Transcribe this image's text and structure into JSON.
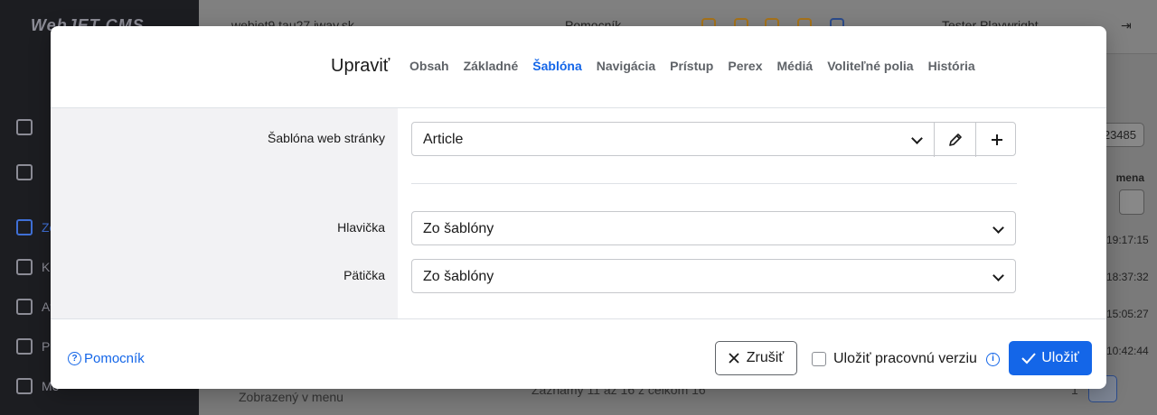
{
  "background": {
    "sidebar": {
      "logo": "WebJET CMS",
      "items": [
        {
          "label": "",
          "icon": "home-icon"
        },
        {
          "label": "",
          "icon": "folder-icon"
        },
        {
          "label": "Zo",
          "icon": "document-icon",
          "active": true
        },
        {
          "label": "Kl",
          "icon": "copy-icon"
        },
        {
          "label": "At",
          "icon": "file-icon"
        },
        {
          "label": "Pre",
          "icon": "export-icon"
        },
        {
          "label": "Mé",
          "icon": "upload-icon"
        }
      ]
    },
    "topbar": {
      "domain": "webjet9.tau27.iway.sk",
      "help": "Pomocník",
      "user": "Tester Playwright"
    },
    "right_column": {
      "id_value": "23485",
      "col_header": "mena",
      "times": [
        "19:17:15",
        "18:37:32",
        "15:05:27",
        "10:42:44"
      ]
    },
    "footer": {
      "folder_label": "Zobrazený v menu",
      "records": "Záznamy 11 až 16 z celkom 16",
      "page_prev": "1",
      "page_current": "2"
    }
  },
  "modal": {
    "title": "Upraviť",
    "tabs": [
      {
        "label": "Obsah",
        "active": false
      },
      {
        "label": "Základné",
        "active": false
      },
      {
        "label": "Šablóna",
        "active": true
      },
      {
        "label": "Navigácia",
        "active": false
      },
      {
        "label": "Prístup",
        "active": false
      },
      {
        "label": "Perex",
        "active": false
      },
      {
        "label": "Médiá",
        "active": false
      },
      {
        "label": "Voliteľné polia",
        "active": false
      },
      {
        "label": "História",
        "active": false
      }
    ],
    "fields": {
      "template": {
        "label": "Šablóna web stránky",
        "value": "Article"
      },
      "header": {
        "label": "Hlavička",
        "value": "Zo šablóny"
      },
      "footer": {
        "label": "Pätička",
        "value": "Zo šablóny"
      }
    },
    "footer": {
      "help": "Pomocník",
      "cancel": "Zrušiť",
      "draft": "Uložiť pracovnú verziu",
      "draft_checked": false,
      "save": "Uložiť"
    }
  },
  "colors": {
    "accent": "#1466e8",
    "label_column_bg": "#f2f2f4",
    "overlay": "#7f7f7f"
  }
}
